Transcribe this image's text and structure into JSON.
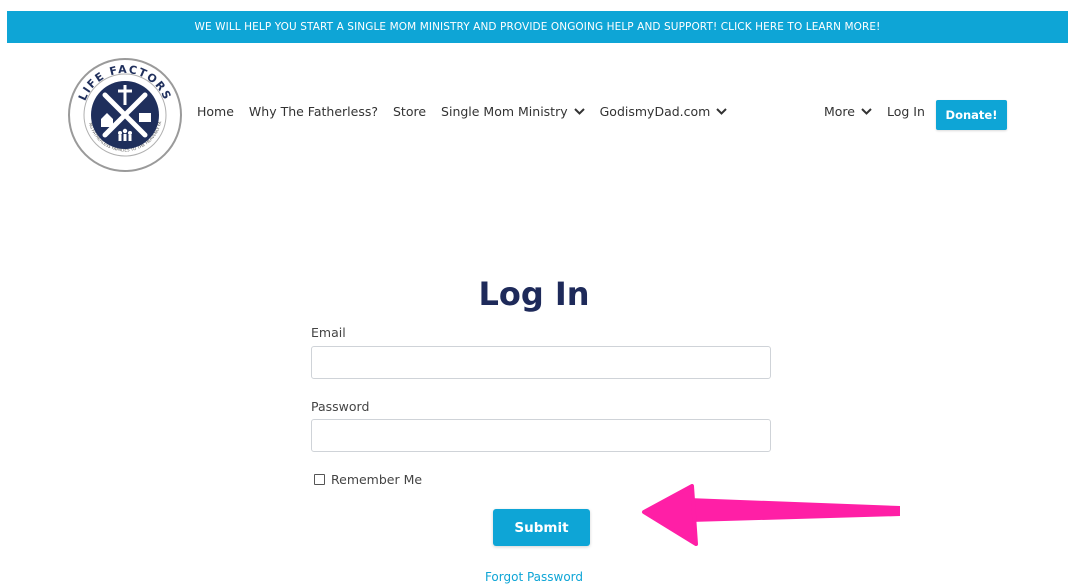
{
  "banner": {
    "text": "WE WILL HELP YOU START A SINGLE MOM MINISTRY AND PROVIDE ONGOING HELP AND SUPPORT! CLICK HERE TO LEARN MORE!"
  },
  "logo": {
    "brand_text": "LIFE FACTORS",
    "tagline": "LEADING FATHERLESS FAMILIES TO THE HEAVENLY FATHER",
    "icon": "logo-emblem"
  },
  "nav": {
    "left_items": [
      {
        "label": "Home",
        "has_dropdown": false
      },
      {
        "label": "Why The Fatherless?",
        "has_dropdown": false
      },
      {
        "label": "Store",
        "has_dropdown": false
      },
      {
        "label": "Single Mom Ministry",
        "has_dropdown": true
      },
      {
        "label": "GodismyDad.com",
        "has_dropdown": true
      }
    ],
    "more_label": "More",
    "login_label": "Log In",
    "donate_label": "Donate!"
  },
  "form": {
    "title": "Log In",
    "email_label": "Email",
    "email_value": "",
    "password_label": "Password",
    "password_value": "",
    "remember_label": "Remember Me",
    "remember_checked": false,
    "submit_label": "Submit",
    "forgot_label": "Forgot Password"
  },
  "annotation": {
    "icon": "pink-arrow",
    "color": "#ff1fa6"
  },
  "colors": {
    "accent": "#0ea5d6",
    "title": "#1e2a5a",
    "logo_navy": "#1f2f5c"
  }
}
